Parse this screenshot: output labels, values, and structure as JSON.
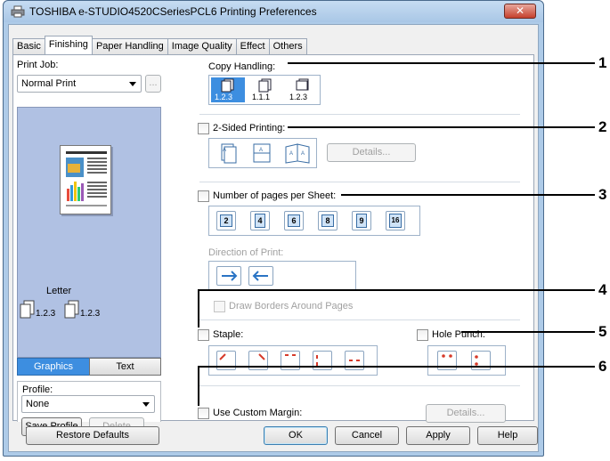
{
  "window": {
    "title": "TOSHIBA e-STUDIO4520CSeriesPCL6 Printing Preferences",
    "close_label": "✕"
  },
  "tabs": [
    "Basic",
    "Finishing",
    "Paper Handling",
    "Image Quality",
    "Effect",
    "Others"
  ],
  "active_tab": "Finishing",
  "left": {
    "print_job_label": "Print Job:",
    "print_job_value": "Normal Print",
    "ellipsis_label": "...",
    "paper_size": "Letter",
    "preview_copy_labels": [
      "1.2.3",
      "1.2.3"
    ],
    "view_buttons": [
      "Graphics",
      "Text"
    ],
    "profile_label": "Profile:",
    "profile_value": "None",
    "save_profile": "Save Profile",
    "delete": "Delete",
    "restore_defaults": "Restore Defaults"
  },
  "copy_handling": {
    "label": "Copy Handling:",
    "options": [
      "1.2.3",
      "1.1.1",
      "1.2.3"
    ],
    "selected_index": 0
  },
  "two_sided": {
    "label": "2-Sided Printing:",
    "checked": false,
    "details": "Details..."
  },
  "pages_per_sheet": {
    "label": "Number of pages per Sheet:",
    "checked": false,
    "options": [
      "2",
      "4",
      "6",
      "8",
      "9",
      "16"
    ],
    "direction_label": "Direction of Print:",
    "draw_borders": "Draw Borders Around Pages"
  },
  "staple": {
    "label": "Staple:",
    "checked": false
  },
  "hole_punch": {
    "label": "Hole Punch:",
    "checked": false
  },
  "custom_margin": {
    "label": "Use Custom Margin:",
    "checked": false,
    "details": "Details..."
  },
  "footer": {
    "ok": "OK",
    "cancel": "Cancel",
    "apply": "Apply",
    "help": "Help"
  },
  "callouts": [
    "1",
    "2",
    "3",
    "4",
    "5",
    "6"
  ],
  "colors": {
    "accent": "#3d8ee0",
    "preview_bg": "#b0c1e3",
    "window_frame": "#aecbe8"
  }
}
